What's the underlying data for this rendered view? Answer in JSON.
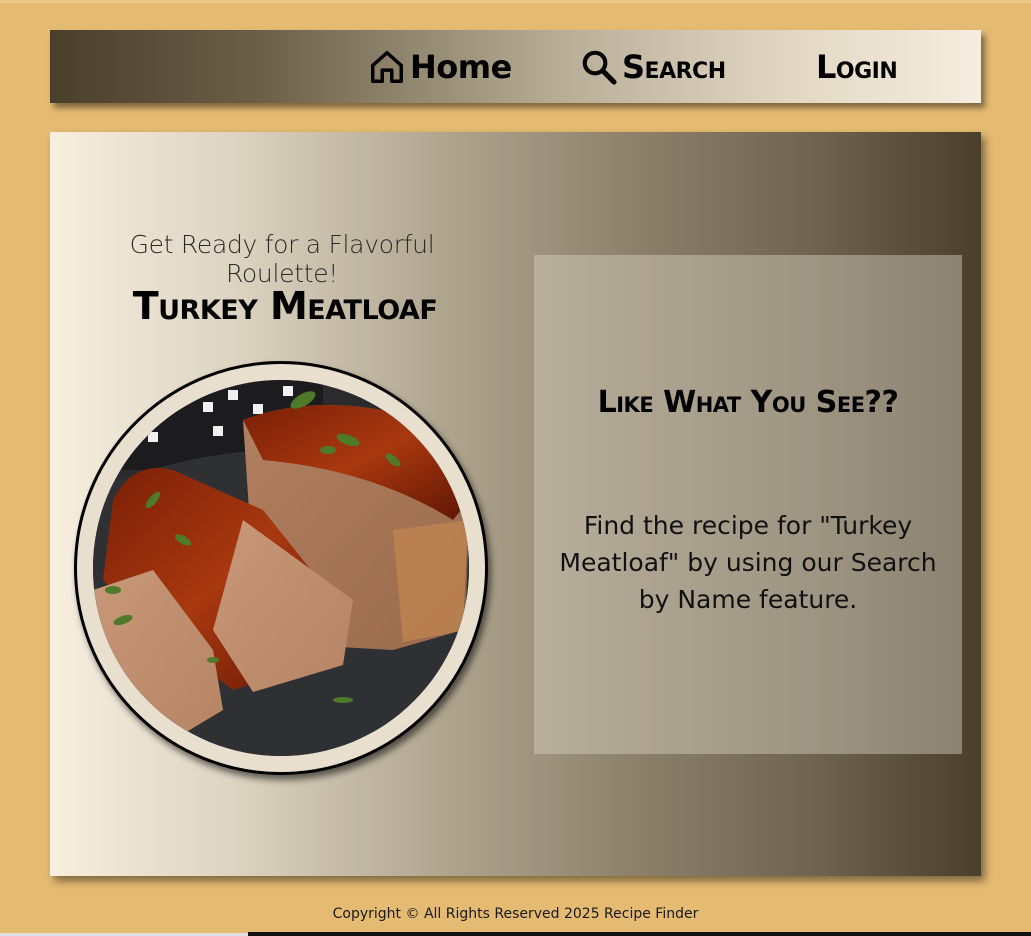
{
  "nav": {
    "home_label": "Home",
    "search_label": "Search",
    "login_label": "Login",
    "home_icon": "home-icon",
    "search_icon": "search-icon"
  },
  "main": {
    "subtitle": "Get Ready for a Flavorful Roulette!",
    "recipe_title": "Turkey Meatloaf",
    "image_alt": "turkey-meatloaf-photo"
  },
  "panel": {
    "heading": "Like What You See??",
    "text": "Find the recipe for \"Turkey Meatloaf\" by using our Search by Name feature."
  },
  "footer": {
    "copyright": "Copyright © All Rights Reserved 2025 Recipe Finder"
  },
  "colors": {
    "page_background": "#e5bb73",
    "nav_dark": "#4a3f2c",
    "nav_light": "#f5ede0",
    "card_light": "#f8efe0",
    "card_dark": "#4a3f2c"
  }
}
